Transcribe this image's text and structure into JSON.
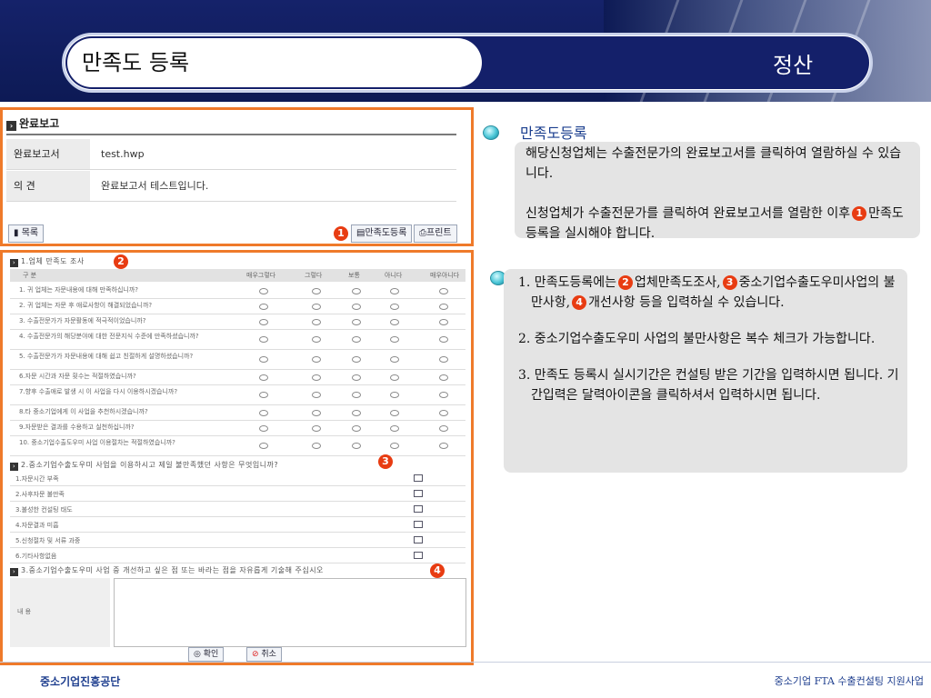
{
  "header": {
    "title": "만족도 등록",
    "section": "정산"
  },
  "report": {
    "heading": "완료보고",
    "rows": [
      {
        "label": "완료보고서",
        "value": "test.hwp"
      },
      {
        "label": "의   견",
        "value": "완료보고서 테스트입니다."
      }
    ],
    "list_button": "목록",
    "survey_button": "만족도등록",
    "print_button": "프린트"
  },
  "survey": {
    "section1": "1.업체 만족도 조사",
    "columns": [
      "구 분",
      "매우그렇다",
      "그렇다",
      "보통",
      "아니다",
      "매우아니다"
    ],
    "questions": [
      "1. 귀 업체는 자문내용에 대해 만족하십니까?",
      "2. 귀 업체는 자문 후 애로사항이 해결되었습니까?",
      "3. 수출전문가가 자문활동에 적극적이었습니까?",
      "4. 수출전문가의 해당분야에 대한 전문지식 수준에 만족하셨습니까?",
      "5. 수출전문가가 자문내용에 대해 쉽고 친절하게 설명하셨습니까?",
      "6.자문 시간과 자문 횟수는 적절하였습니까?",
      "7.향후 수출애로 발생 시 이 사업을 다시 이용하시겠습니까?",
      "8.타 중소기업에게 이 사업을 추천하시겠습니까?",
      "9.자문받은 결과를 수용하고 실천하십니까?",
      "10. 중소기업수출도우미 사업 이용절차는 적절하였습니까?"
    ],
    "section2": "2.중소기업수출도우미 사업을 이용하시고 제일 불만족했던 사항은 무엇입니까?",
    "complaints": [
      "1.자문시간 부족",
      "2.사후자문 불만족",
      "3.불성한 컨설팅 태도",
      "4.자문결과 미흡",
      "5.신청절차 및 서류 과중",
      "6.기타사항없음"
    ],
    "section3": "3.중소기업수출도우미 사업 중 개선하고 싶은 점 또는 바라는 점을 자유롭게 기술해 주십시오",
    "textarea_label": "내 용",
    "confirm_button": "확인",
    "cancel_button": "취소"
  },
  "markers": [
    "1",
    "2",
    "3",
    "4"
  ],
  "callout1": {
    "title": "만족도등록",
    "line1": "해당신청업체는 수출전문가의 완료보고서를 클릭하여 열람하실 수 있습니다.",
    "line2_a": "신청업체가 수출전문가를 클릭하여 완료보고서를 열람한 이후",
    "line2_b": "만족도등록을 실시해야 합니다."
  },
  "callout2": {
    "item1_a": "1.  만족도등록에는",
    "item1_b": "업체만족도조사,",
    "item1_c": "중소기업수출도우미사업의 불만사항,",
    "item1_d": "개선사항 등을 입력하실 수 있습니다.",
    "item2": "2.  중소기업수출도우미 사업의 불만사항은 복수 체크가 가능합니다.",
    "item3": "3. 만족도 등록시 실시기간은 컨설팅 받은 기간을 입력하시면 됩니다. 기간입력은 달력아이콘을 클릭하셔서 입력하시면 됩니다."
  },
  "footer": {
    "left": "중소기업진흥공단",
    "right": "중소기업 FTA 수출컨설팅 지원사업"
  },
  "colors": {
    "navy": "#14206a",
    "highlight_border": "#ef7a2a",
    "marker": "#e83c12",
    "callout_title": "#1b3f8f"
  }
}
